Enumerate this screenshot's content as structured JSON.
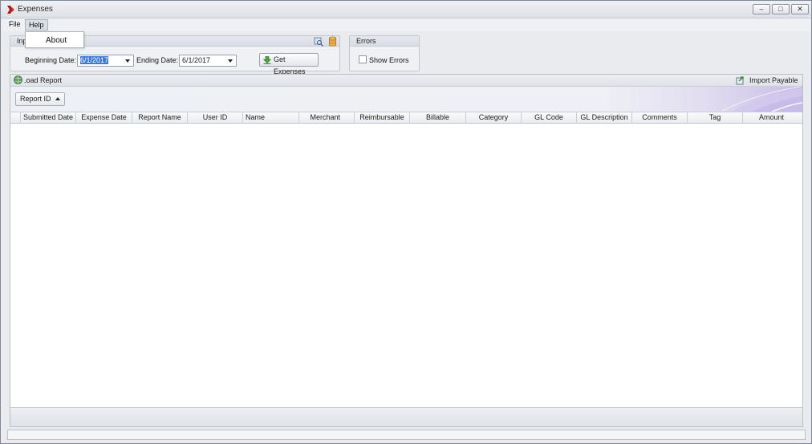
{
  "window": {
    "title": "Expenses"
  },
  "menu": {
    "file": "File",
    "help": "Help",
    "help_items": [
      "About"
    ]
  },
  "import_group": {
    "caption_partial": "Inp",
    "beginning_label": "Beginning Date:",
    "beginning_value": "6/1/2017",
    "ending_label": "Ending Date:",
    "ending_value": "6/1/2017",
    "get_expenses": "Get Expenses"
  },
  "errors_group": {
    "caption": "Errors",
    "show_errors": "Show Errors",
    "show_errors_checked": false
  },
  "report_panel": {
    "title": "Load Report",
    "title_visible": ".oad Report",
    "import_payable": "Import Payable",
    "group_by": "Report ID",
    "columns": [
      "Submitted Date",
      "Expense Date",
      "Report Name",
      "User ID",
      "Name",
      "Merchant",
      "Reimbursable",
      "Billable",
      "Category",
      "GL Code",
      "GL Description",
      "Comments",
      "Tag",
      "Amount"
    ],
    "rows": []
  }
}
